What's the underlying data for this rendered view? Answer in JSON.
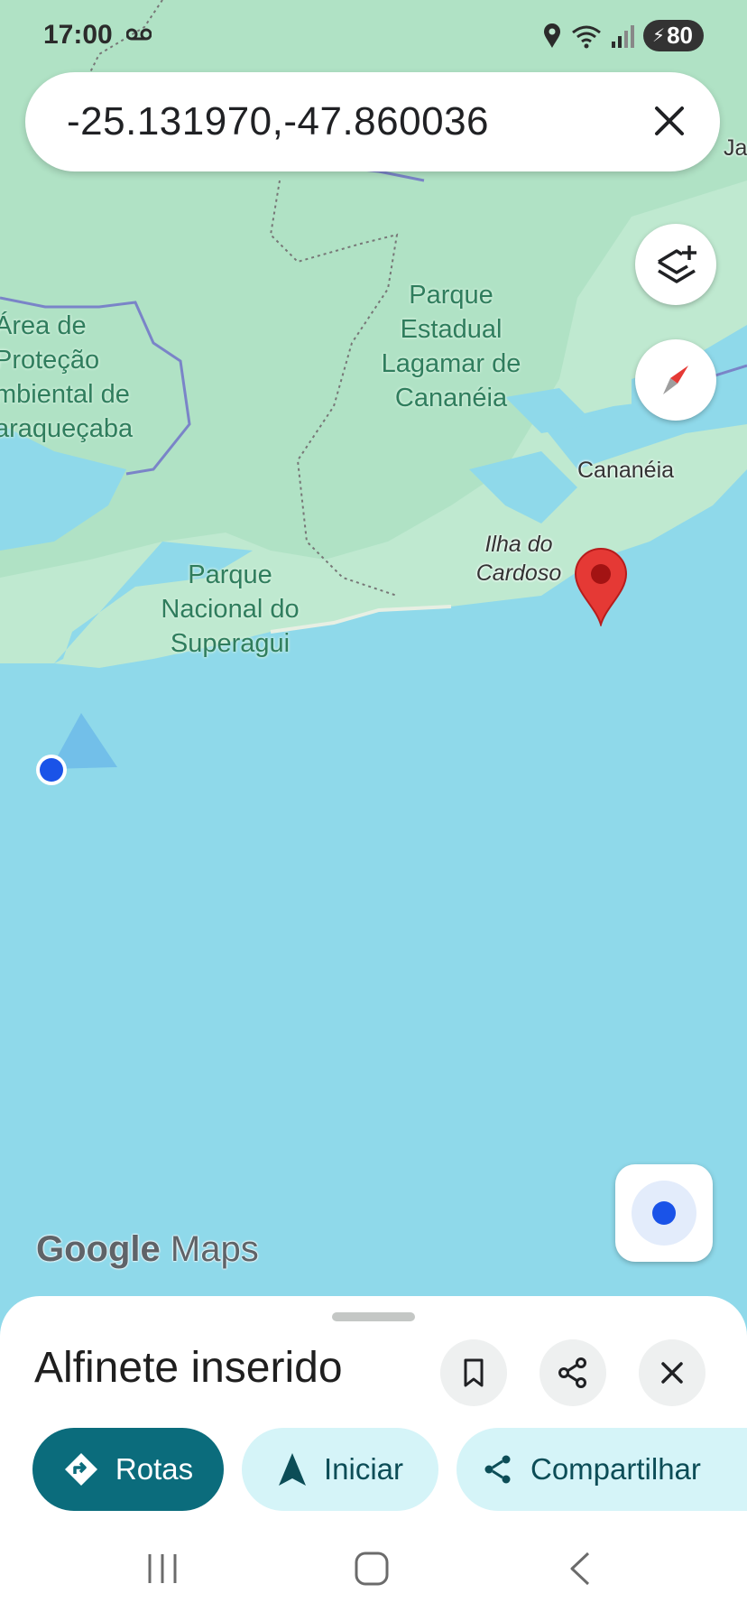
{
  "status_bar": {
    "time": "17:00",
    "battery": "80",
    "icons": [
      "voicemail-icon",
      "location-icon",
      "wifi-icon",
      "signal-icon",
      "battery-icon"
    ]
  },
  "search": {
    "query": "-25.131970,-47.860036",
    "clear_icon": "close-icon"
  },
  "map": {
    "labels": {
      "area_protecao": [
        "Área de",
        "Proteção",
        "mbiental de",
        "araqueçaba"
      ],
      "parque_estadual": [
        "Parque",
        "Estadual",
        "Lagamar de",
        "Cananéia"
      ],
      "cananeia": "Cananéia",
      "ilha_cardoso": [
        "Ilha do",
        "Cardoso"
      ],
      "parque_nacional": [
        "Parque",
        "Nacional do",
        "Superagui"
      ],
      "edge_label": "Ja"
    },
    "logo": {
      "google": "Google",
      "maps": "Maps"
    },
    "colors": {
      "land": "#bfe9d0",
      "park": "#a7dcb9",
      "water": "#8fd9ea",
      "pin": "#e53935",
      "location": "#1a73e8"
    }
  },
  "sheet": {
    "title": "Alfinete inserido",
    "actions": {
      "routes": "Rotas",
      "start": "Iniciar",
      "share": "Compartilhar"
    },
    "icon_buttons": [
      "bookmark-icon",
      "share-icon",
      "close-icon"
    ]
  },
  "nav": [
    "recents-icon",
    "home-icon",
    "back-icon"
  ]
}
